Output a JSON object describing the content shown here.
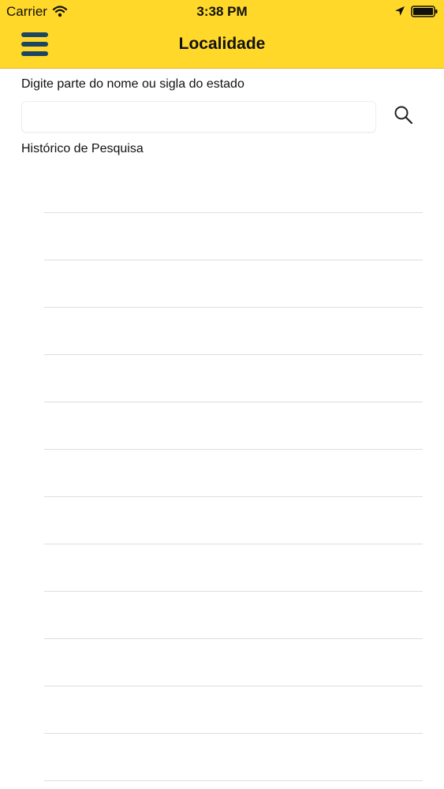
{
  "status_bar": {
    "carrier": "Carrier",
    "time": "3:38 PM",
    "icons": [
      "wifi-icon",
      "location-arrow-icon",
      "battery-icon"
    ]
  },
  "header": {
    "menu_icon": "hamburger-menu-icon",
    "title": "Localidade",
    "background_color": "#FFD829",
    "menu_color": "#1B4563"
  },
  "search": {
    "prompt": "Digite parte do nome ou sigla do estado",
    "value": "",
    "placeholder": "",
    "button_icon": "search-icon"
  },
  "history": {
    "label": "Histórico de Pesquisa",
    "items": [
      "",
      "",
      "",
      "",
      "",
      "",
      "",
      "",
      "",
      "",
      "",
      "",
      "",
      ""
    ]
  }
}
